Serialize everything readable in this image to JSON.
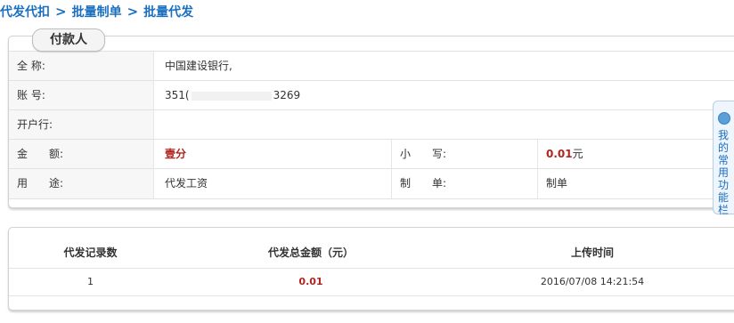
{
  "breadcrumb": {
    "items": [
      "代发代扣",
      "批量制单",
      "批量代发"
    ],
    "separator": ">"
  },
  "payer": {
    "tab_title": "付款人",
    "rows": [
      {
        "label": "全 称:",
        "value": "中国建设银行,"
      },
      {
        "label": "账 号:",
        "value_prefix": "351(",
        "value_suffix": "3269"
      },
      {
        "label": "开户行:",
        "value": ""
      }
    ],
    "amount_label": "金　　额:",
    "amount_upper": "壹分",
    "amount_small_label": "小　　写:",
    "amount_small_value": "0.01",
    "amount_small_unit": "元",
    "purpose_label": "用　　途:",
    "purpose_value": "代发工资",
    "maker_label": "制　　单:",
    "maker_value": "制单"
  },
  "summary": {
    "headers": [
      "代发记录数",
      "代发总金额（元）",
      "上传时间"
    ],
    "row": {
      "count": "1",
      "total": "0.01",
      "uploaded": "2016/07/08 14:21:54"
    }
  },
  "side_widget": {
    "label": "我的常用功能栏",
    "icon": "circle-icon"
  },
  "colors": {
    "link_blue": "#1a6fbf",
    "amount_red": "#b3241f"
  }
}
